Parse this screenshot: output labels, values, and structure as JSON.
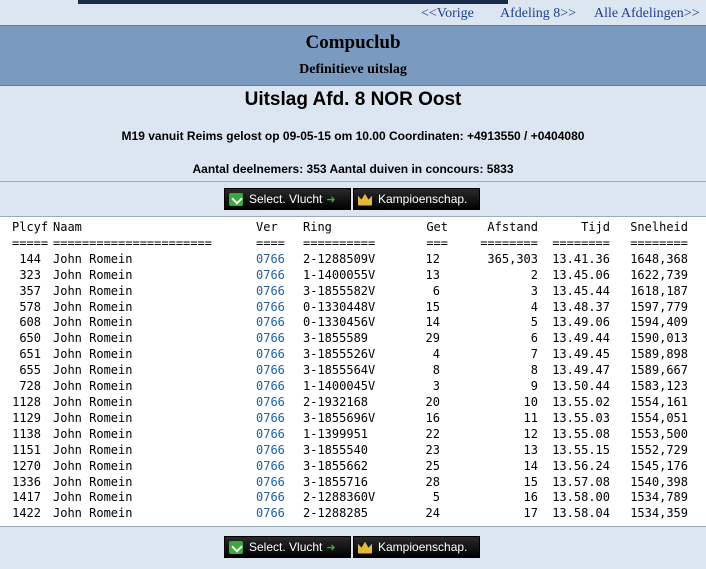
{
  "nav": {
    "prev": "<<Vorige",
    "next": "Afdeling 8>>",
    "all": "Alle Afdelingen>>"
  },
  "header": {
    "club": "Compuclub",
    "subtitle": "Definitieve uitslag"
  },
  "race": {
    "title": "Uitslag Afd. 8 NOR Oost",
    "info": "M19 vanuit Reims gelost op 09-05-15 om 10.00 Coordinaten: +4913550 / +0404080",
    "count": "Aantal deelnemers: 353 Aantal duiven in concours: 5833"
  },
  "buttons": {
    "select": "Select. Vlucht",
    "kampioen": "Kampioenschap."
  },
  "icons": {
    "select": "download-icon",
    "select_arrow": "arrow-right-icon",
    "kampioen": "crown-icon"
  },
  "table": {
    "headers": [
      "Plcyf",
      "Naam",
      "Ver",
      "Ring",
      "Get",
      "Afstand",
      "Tijd",
      "Snelheid"
    ],
    "underlines": [
      "=====",
      "======================",
      "====",
      "==========",
      "===",
      "========",
      "========",
      "========"
    ],
    "rows": [
      [
        "144",
        "John Romein",
        "0766",
        "2-1288509V",
        "12",
        "365,303",
        "13.41.36",
        "1648,368"
      ],
      [
        "323",
        "John Romein",
        "0766",
        "1-1400055V",
        "13",
        "2",
        "13.45.06",
        "1622,739"
      ],
      [
        "357",
        "John Romein",
        "0766",
        "3-1855582V",
        "6",
        "3",
        "13.45.44",
        "1618,187"
      ],
      [
        "578",
        "John Romein",
        "0766",
        "0-1330448V",
        "15",
        "4",
        "13.48.37",
        "1597,779"
      ],
      [
        "608",
        "John Romein",
        "0766",
        "0-1330456V",
        "14",
        "5",
        "13.49.06",
        "1594,409"
      ],
      [
        "650",
        "John Romein",
        "0766",
        "3-1855589",
        "29",
        "6",
        "13.49.44",
        "1590,013"
      ],
      [
        "651",
        "John Romein",
        "0766",
        "3-1855526V",
        "4",
        "7",
        "13.49.45",
        "1589,898"
      ],
      [
        "655",
        "John Romein",
        "0766",
        "3-1855564V",
        "8",
        "8",
        "13.49.47",
        "1589,667"
      ],
      [
        "728",
        "John Romein",
        "0766",
        "1-1400045V",
        "3",
        "9",
        "13.50.44",
        "1583,123"
      ],
      [
        "1128",
        "John Romein",
        "0766",
        "2-1932168",
        "20",
        "10",
        "13.55.02",
        "1554,161"
      ],
      [
        "1129",
        "John Romein",
        "0766",
        "3-1855696V",
        "16",
        "11",
        "13.55.03",
        "1554,051"
      ],
      [
        "1138",
        "John Romein",
        "0766",
        "1-1399951",
        "22",
        "12",
        "13.55.08",
        "1553,500"
      ],
      [
        "1151",
        "John Romein",
        "0766",
        "3-1855540",
        "23",
        "13",
        "13.55.15",
        "1552,729"
      ],
      [
        "1270",
        "John Romein",
        "0766",
        "3-1855662",
        "25",
        "14",
        "13.56.24",
        "1545,176"
      ],
      [
        "1336",
        "John Romein",
        "0766",
        "3-1855716",
        "28",
        "15",
        "13.57.08",
        "1540,398"
      ],
      [
        "1417",
        "John Romein",
        "0766",
        "2-1288360V",
        "5",
        "16",
        "13.58.00",
        "1534,789"
      ],
      [
        "1422",
        "John Romein",
        "0766",
        "2-1288285",
        "24",
        "17",
        "13.58.04",
        "1534,359"
      ]
    ]
  }
}
